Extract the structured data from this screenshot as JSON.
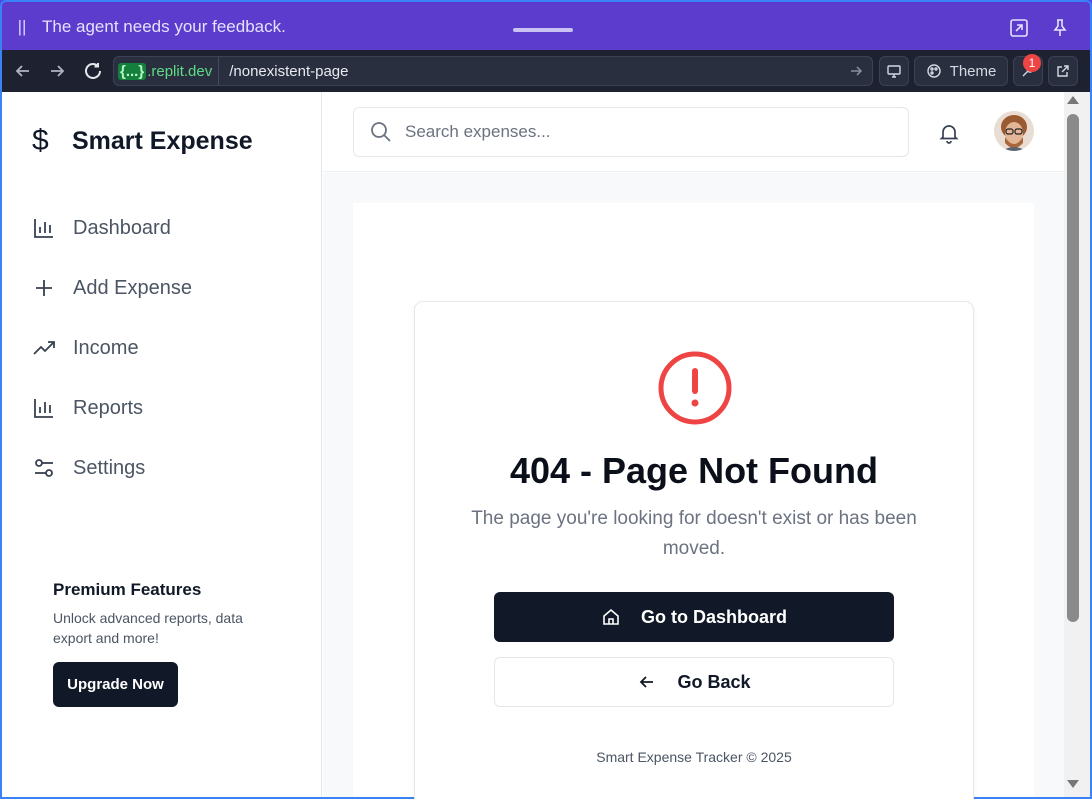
{
  "agent_banner": {
    "pause_icon": "pause-icon",
    "message": "The agent needs your feedback.",
    "icons": [
      "expand-icon",
      "pin-icon"
    ]
  },
  "browser": {
    "url_host_badge": "{...}",
    "url_host": ".replit.dev",
    "url_path": "/nonexistent-page",
    "theme_label": "Theme",
    "notification_count": "1"
  },
  "sidebar": {
    "brand": "Smart Expense",
    "items": [
      {
        "label": "Dashboard",
        "icon": "bar-chart-icon"
      },
      {
        "label": "Add Expense",
        "icon": "plus-icon"
      },
      {
        "label": "Income",
        "icon": "trending-up-icon"
      },
      {
        "label": "Reports",
        "icon": "bar-chart-icon"
      },
      {
        "label": "Settings",
        "icon": "sliders-icon"
      }
    ],
    "premium": {
      "title": "Premium Features",
      "description": "Unlock advanced reports, data export and more!",
      "button": "Upgrade Now"
    }
  },
  "header": {
    "search_placeholder": "Search expenses..."
  },
  "error": {
    "title": "404 - Page Not Found",
    "message": "The page you're looking for doesn't exist or has been moved.",
    "primary_button": "Go to Dashboard",
    "secondary_button": "Go Back",
    "footer": "Smart Expense Tracker © 2025"
  },
  "colors": {
    "agent_banner": "#5b3ccc",
    "accent_dark": "#111827",
    "error_red": "#ef4444"
  }
}
